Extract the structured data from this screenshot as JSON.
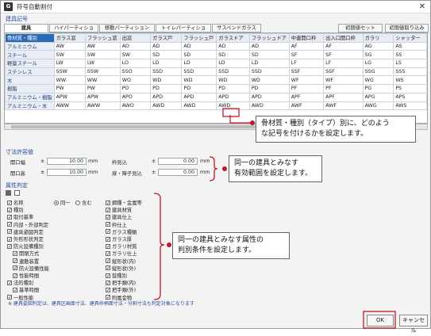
{
  "window": {
    "title": "符号自動割付",
    "app_icon": "G"
  },
  "sections": {
    "kigou": "建具記号",
    "sunpo": "寸法許容値",
    "zokusei": "属性判定"
  },
  "tabs": [
    "建具",
    "ハイパーティション",
    "移動パーティション",
    "トイレパーティション",
    "サスペンドガラス"
  ],
  "buttons": {
    "init_set": "初期値セット",
    "init_load": "初期値取り込み",
    "ok": "OK",
    "cancel": "キャンセル"
  },
  "table": {
    "headers": [
      "骨材質・種別",
      "ガラス窓",
      "フラッシュ窓",
      "出窓",
      "ガラス戸",
      "フラッシュ戸",
      "ガラスドア",
      "フラッシュドア",
      "中連開口枠",
      "出入口開口枠",
      "ガラリ",
      "シャッター"
    ],
    "rows": [
      [
        "アルミニウム",
        "AW",
        "AW",
        "AO",
        "AD",
        "AD",
        "AD",
        "AD",
        "AF",
        "AF",
        "AG",
        "AS"
      ],
      [
        "スチール",
        "SW",
        "SW",
        "SW",
        "SD",
        "SD",
        "SD",
        "SD",
        "SF",
        "SF",
        "SG",
        "SS"
      ],
      [
        "軽量スチール",
        "LW",
        "LW",
        "LO",
        "LD",
        "LD",
        "LD",
        "LD",
        "LF",
        "LF",
        "LG",
        "LS"
      ],
      [
        "ステンレス",
        "SSW",
        "SSW",
        "SSO",
        "SSD",
        "SSD",
        "SSD",
        "SSD",
        "SSF",
        "SSF",
        "SSG",
        "SSS"
      ],
      [
        "木",
        "WW",
        "WW",
        "WO",
        "WD",
        "WD",
        "WD",
        "WD",
        "WF",
        "WF",
        "WG",
        "WS"
      ],
      [
        "樹脂",
        "PW",
        "PW",
        "PO",
        "PD",
        "PD",
        "PD",
        "PD",
        "PF",
        "PF",
        "PG",
        "PS"
      ],
      [
        "アルミニウム・樹脂",
        "APW",
        "APW",
        "APO",
        "APD",
        "APD",
        "APD",
        "APD",
        "APF",
        "APF",
        "APG",
        "APS"
      ],
      [
        "アルミニウム・木",
        "AWW",
        "AWW",
        "AWO",
        "AWD",
        "AWD",
        "AWD",
        "AWD",
        "AWF",
        "AWF",
        "AWG",
        "AWS"
      ]
    ]
  },
  "tolerance": {
    "open_width_label": "開口幅",
    "open_width_val": "10.00",
    "open_width_unit": "mm",
    "open_height_label": "開口高",
    "open_height_val": "10.00",
    "open_height_unit": "mm",
    "frame_label": "枠見込",
    "frame_val": "0.00",
    "frame_unit": "mm",
    "sash_label": "扉・障子見込",
    "sash_val": "0.00",
    "sash_unit": "mm",
    "pm": "±"
  },
  "attrs_left": [
    {
      "label": "名称",
      "checked": true
    },
    {
      "label": "種別",
      "checked": true
    },
    {
      "label": "取付基準",
      "checked": true
    },
    {
      "label": "内部・外部判定",
      "checked": true
    },
    {
      "label": "建具姿図判定",
      "checked": true
    },
    {
      "label": "外形形状判定",
      "checked": true
    },
    {
      "label": "防火設備種別",
      "checked": true
    },
    {
      "label": "開閉方式",
      "checked": true
    },
    {
      "label": "連動装置",
      "checked": true
    },
    {
      "label": "防火設備性能",
      "checked": true
    },
    {
      "label": "性能時間",
      "checked": true
    },
    {
      "label": "法的種別",
      "checked": true
    },
    {
      "label": "基準時間",
      "checked": true
    },
    {
      "label": "一般性能",
      "checked": true
    }
  ],
  "name_options": {
    "same": "同一",
    "contains": "含む"
  },
  "attrs_right": [
    {
      "label": "鋼種・金属等",
      "checked": true
    },
    {
      "label": "建具材質",
      "checked": true
    },
    {
      "label": "建具仕上",
      "checked": true
    },
    {
      "label": "枠仕上",
      "checked": true
    },
    {
      "label": "ガラス種類",
      "checked": true
    },
    {
      "label": "ガラス厚",
      "checked": true
    },
    {
      "label": "ガラリ材質",
      "checked": true
    },
    {
      "label": "ガラリ仕上",
      "checked": true
    },
    {
      "label": "縦形状(内)",
      "checked": true
    },
    {
      "label": "縦形状(外)",
      "checked": true
    },
    {
      "label": "錠種別",
      "checked": true
    },
    {
      "label": "把手類(内)",
      "checked": true
    },
    {
      "label": "把手類(外)",
      "checked": true
    },
    {
      "label": "附属金物",
      "checked": true
    }
  ],
  "note": "※ 建具姿図判定は、建具区画面寸法、建具枠柄面寸法・分割寸法も判定対象になります",
  "callouts": {
    "c1": "骨材質・種別（タイプ）別に、どのよう\nな記号を付けるかを設定します。",
    "c2": "同一の建具とみなす\n有効範囲を設定します。",
    "c3": "同一の建具とみなす属性の\n判別条件を設定します。"
  },
  "colors": {
    "accent": "#2a6ab5",
    "callout_red": "#c0182a"
  }
}
